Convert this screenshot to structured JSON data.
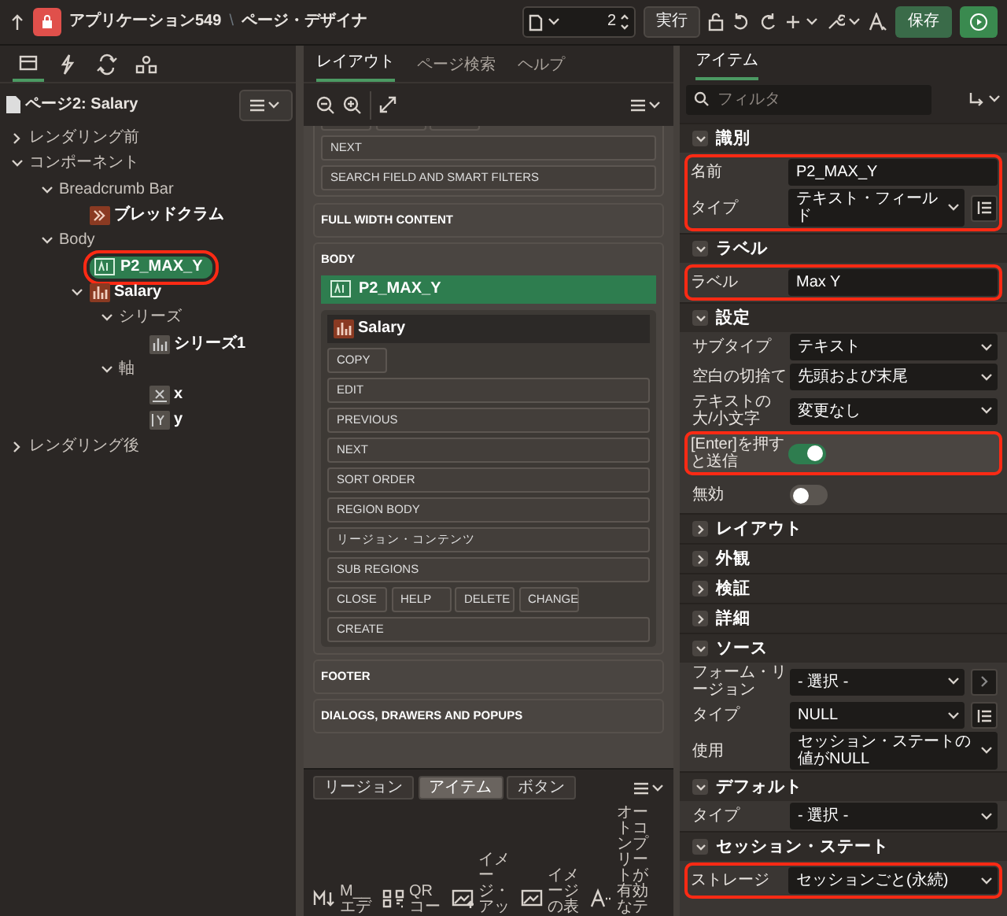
{
  "topbar": {
    "app_title": "アプリケーション549",
    "separator": "\\",
    "page_title": "ページ・デザイナ",
    "page_number": "2",
    "run_label": "実行",
    "save_label": "保存"
  },
  "left": {
    "tabs": [
      {
        "selected": true
      },
      {
        "selected": false
      },
      {
        "selected": false
      },
      {
        "selected": false
      }
    ],
    "page_label": "ページ2: Salary",
    "tree": [
      {
        "label": "レンダリング前",
        "expanded": false,
        "selected": false,
        "highlighted": false
      },
      {
        "label": "コンポーネント",
        "expanded": true,
        "selected": false,
        "highlighted": false,
        "children": [
          {
            "label": "Breadcrumb Bar",
            "expanded": true,
            "selected": false,
            "highlighted": false,
            "children": [
              {
                "label": "ブレッドクラム",
                "kind": "breadcrumb",
                "selected": false,
                "highlighted": false
              }
            ]
          },
          {
            "label": "Body",
            "expanded": true,
            "selected": false,
            "highlighted": false,
            "children": [
              {
                "label": "P2_MAX_Y",
                "kind": "item",
                "selected": true,
                "highlighted": true
              },
              {
                "label": "Salary",
                "kind": "chart",
                "expanded": true,
                "selected": false,
                "highlighted": false,
                "children": [
                  {
                    "label": "シリーズ",
                    "expanded": true,
                    "selected": false,
                    "highlighted": false,
                    "children": [
                      {
                        "label": "シリーズ1",
                        "kind": "series",
                        "selected": false,
                        "highlighted": false
                      }
                    ]
                  },
                  {
                    "label": "軸",
                    "expanded": true,
                    "selected": false,
                    "highlighted": false,
                    "children": [
                      {
                        "label": "x",
                        "kind": "axis-x",
                        "selected": false,
                        "highlighted": false
                      },
                      {
                        "label": "y",
                        "kind": "axis-y",
                        "selected": false,
                        "highlighted": false
                      }
                    ]
                  }
                ]
              }
            ]
          }
        ]
      },
      {
        "label": "レンダリング後",
        "expanded": false,
        "selected": false,
        "highlighted": false
      }
    ]
  },
  "middle": {
    "tabs": [
      {
        "label": "レイアウト",
        "selected": true
      },
      {
        "label": "ページ検索",
        "selected": false
      },
      {
        "label": "ヘルプ",
        "selected": false
      }
    ],
    "top_slots": [
      "NEXT",
      "SEARCH FIELD AND SMART FILTERS"
    ],
    "sections": [
      {
        "title": "FULL WIDTH CONTENT"
      },
      {
        "title": "BODY",
        "item": "P2_MAX_Y",
        "region": {
          "title": "Salary",
          "rows": [
            {
              "kind": "narrow",
              "slots": [
                "COPY"
              ]
            },
            {
              "kind": "wide",
              "slots": [
                "EDIT"
              ]
            },
            {
              "kind": "wide",
              "slots": [
                "PREVIOUS"
              ]
            },
            {
              "kind": "wide",
              "slots": [
                "NEXT"
              ]
            },
            {
              "kind": "wide",
              "slots": [
                "SORT ORDER"
              ]
            },
            {
              "kind": "wide",
              "slots": [
                "REGION BODY"
              ]
            },
            {
              "kind": "wide",
              "slots": [
                "リージョン・コンテンツ"
              ]
            },
            {
              "kind": "wide",
              "slots": [
                "SUB REGIONS"
              ]
            },
            {
              "kind": "narrow",
              "slots": [
                "CLOSE",
                "HELP",
                "DELETE",
                "CHANGE"
              ]
            },
            {
              "kind": "wide",
              "slots": [
                "CREATE"
              ]
            }
          ]
        }
      },
      {
        "title": "FOOTER"
      },
      {
        "title": "DIALOGS, DRAWERS AND POPUPS"
      }
    ],
    "gallery": {
      "tabs": [
        {
          "label": "リージョン",
          "selected": false
        },
        {
          "label": "アイテム",
          "selected": true
        },
        {
          "label": "ボタン",
          "selected": false
        }
      ],
      "items": [
        {
          "label": "M__エデ"
        },
        {
          "label": "QRコー"
        },
        {
          "label": "イメージ・アッ"
        },
        {
          "label": "イメージの表"
        },
        {
          "label": "オートコンプリートが有効なテ"
        }
      ]
    }
  },
  "right": {
    "tab": "アイテム",
    "filter_placeholder": "フィルタ",
    "groups": [
      {
        "title": "識別",
        "expanded": true,
        "rows": [
          {
            "label": "名前",
            "kind": "text",
            "value": "P2_MAX_Y",
            "highlighted": true
          },
          {
            "label": "タイプ",
            "kind": "select",
            "value": "テキスト・フィールド",
            "button": {
              "kind": "list"
            },
            "highlighted": true
          }
        ]
      },
      {
        "title": "ラベル",
        "expanded": true,
        "rows": [
          {
            "label": "ラベル",
            "kind": "text",
            "value": "Max Y",
            "highlighted": true
          }
        ]
      },
      {
        "title": "設定",
        "expanded": true,
        "rows": [
          {
            "label": "サブタイプ",
            "kind": "select",
            "value": "テキスト",
            "highlighted": false
          },
          {
            "label": "空白の切捨て",
            "kind": "select",
            "value": "先頭および末尾",
            "highlighted": false
          },
          {
            "label": "テキストの大/小文字",
            "kind": "select",
            "value": "変更なし",
            "highlighted": false
          },
          {
            "label": "[Enter]を押すと送信",
            "kind": "toggle",
            "on": true,
            "highlighted": true
          },
          {
            "label": "無効",
            "kind": "toggle",
            "on": false,
            "highlighted": false
          }
        ]
      },
      {
        "title": "レイアウト",
        "expanded": false
      },
      {
        "title": "外観",
        "expanded": false
      },
      {
        "title": "検証",
        "expanded": false
      },
      {
        "title": "詳細",
        "expanded": false
      },
      {
        "title": "ソース",
        "expanded": true,
        "rows": [
          {
            "label": "フォーム・リージョン",
            "kind": "select",
            "value": "- 選択 -",
            "button": {
              "kind": "arrow"
            },
            "highlighted": false
          },
          {
            "label": "タイプ",
            "kind": "select",
            "value": "NULL",
            "button": {
              "kind": "list"
            },
            "highlighted": false
          },
          {
            "label": "使用",
            "kind": "select",
            "value": "セッション・ステートの値がNULL",
            "highlighted": false
          }
        ]
      },
      {
        "title": "デフォルト",
        "expanded": true,
        "rows": [
          {
            "label": "タイプ",
            "kind": "select",
            "value": "- 選択 -",
            "highlighted": false
          }
        ]
      },
      {
        "title": "セッション・ステート",
        "expanded": true,
        "rows": [
          {
            "label": "ストレージ",
            "kind": "select",
            "value": "セッションごと(永続)",
            "highlighted": true
          }
        ]
      }
    ]
  }
}
